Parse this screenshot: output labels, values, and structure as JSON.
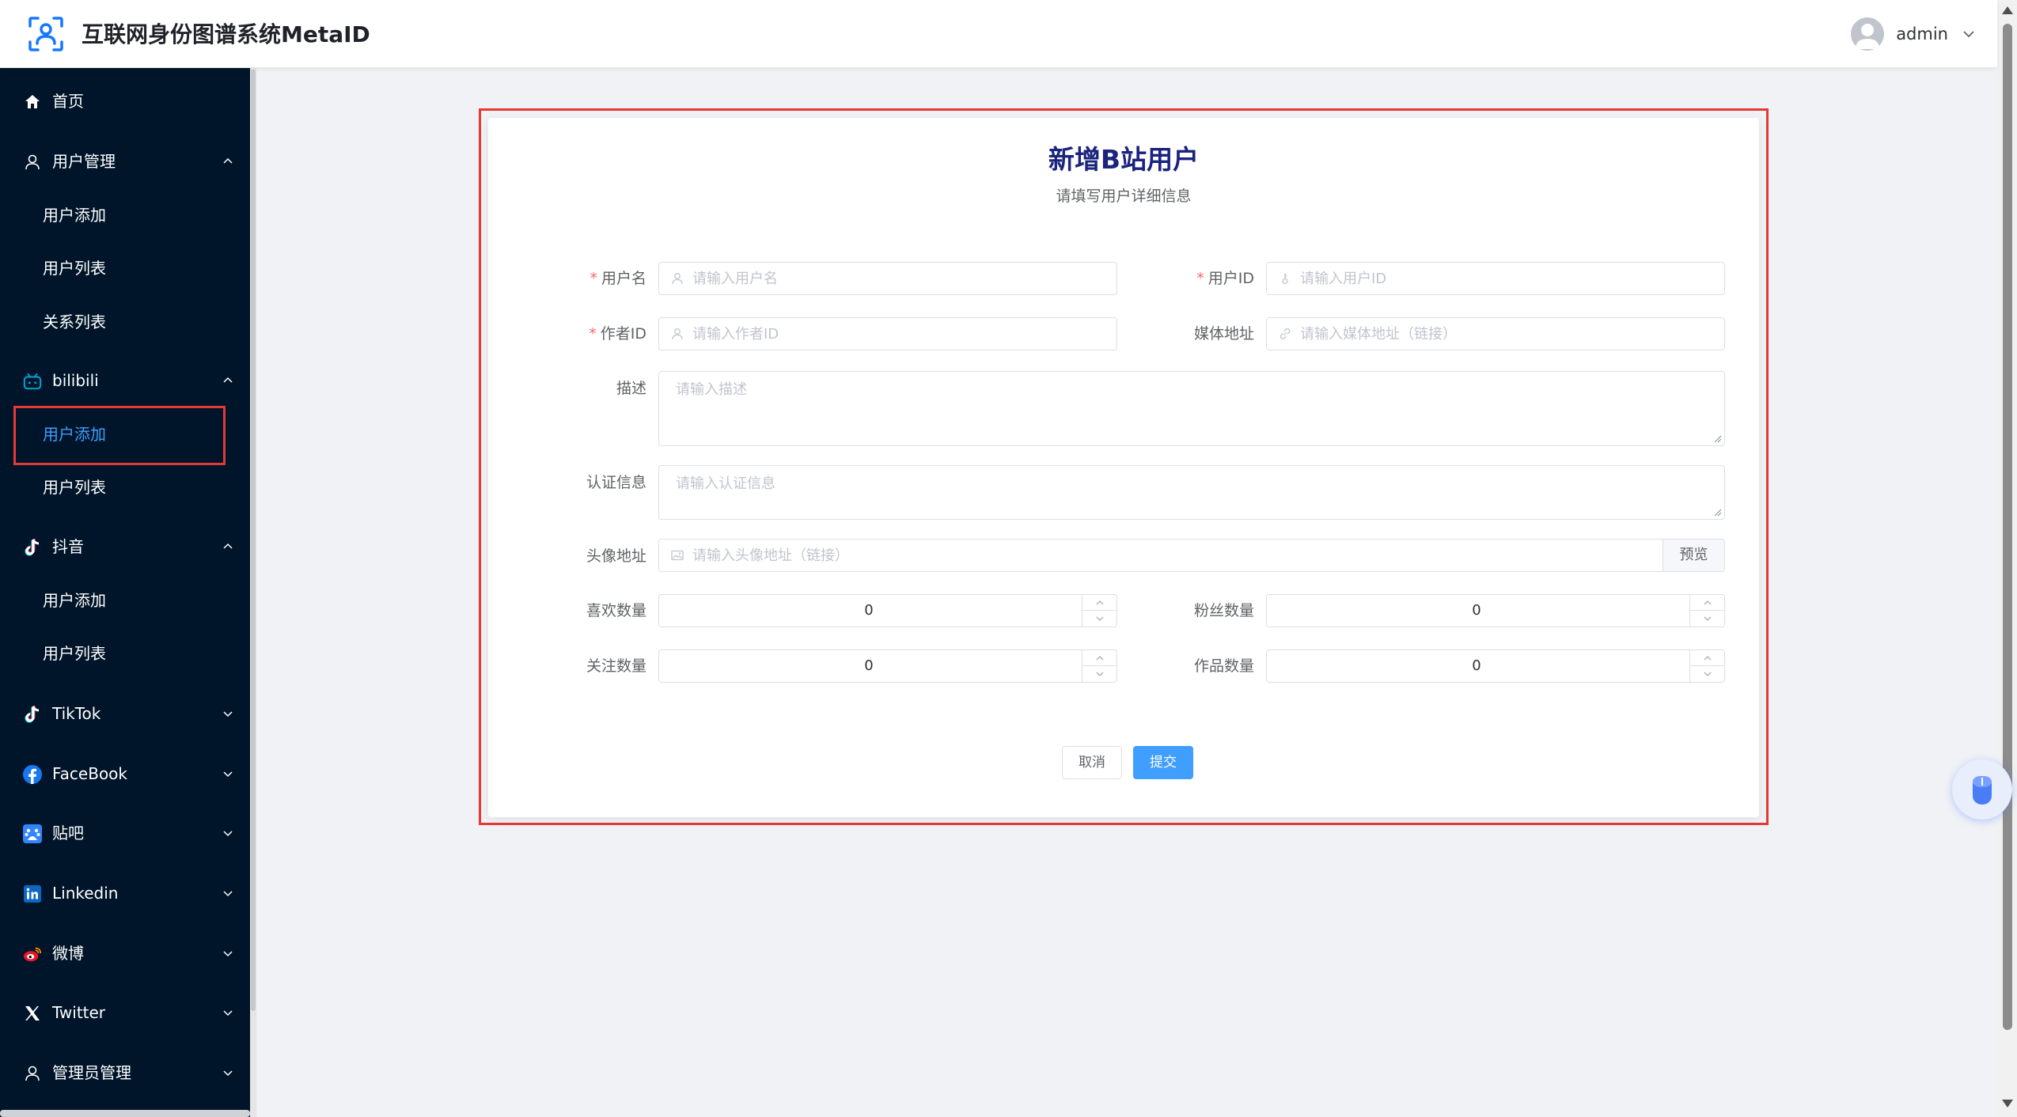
{
  "header": {
    "app_title": "互联网身份图谱系统MetaID",
    "user_name": "admin"
  },
  "sidebar": {
    "items": [
      {
        "label": "首页",
        "icon": "home-icon"
      },
      {
        "label": "用户管理",
        "icon": "user-icon",
        "expanded": true,
        "children": [
          "用户添加",
          "用户列表",
          "关系列表"
        ]
      },
      {
        "label": "bilibili",
        "icon": "bilibili-icon",
        "expanded": true,
        "children": [
          "用户添加",
          "用户列表"
        ]
      },
      {
        "label": "抖音",
        "icon": "douyin-icon",
        "expanded": true,
        "children": [
          "用户添加",
          "用户列表"
        ]
      },
      {
        "label": "TikTok",
        "icon": "tiktok-icon"
      },
      {
        "label": "FaceBook",
        "icon": "facebook-icon"
      },
      {
        "label": "贴吧",
        "icon": "tieba-icon"
      },
      {
        "label": "Linkedin",
        "icon": "linkedin-icon"
      },
      {
        "label": "微博",
        "icon": "weibo-icon"
      },
      {
        "label": "Twitter",
        "icon": "x-icon"
      },
      {
        "label": "管理员管理",
        "icon": "admin-user-icon"
      }
    ],
    "active_item": "bilibili > 用户添加"
  },
  "form": {
    "title": "新增B站用户",
    "subtitle": "请填写用户详细信息",
    "fields": {
      "username": {
        "label": "用户名",
        "placeholder": "请输入用户名",
        "required": true
      },
      "user_id": {
        "label": "用户ID",
        "placeholder": "请输入用户ID",
        "required": true
      },
      "author_id": {
        "label": "作者ID",
        "placeholder": "请输入作者ID",
        "required": true
      },
      "media_url": {
        "label": "媒体地址",
        "placeholder": "请输入媒体地址（链接）"
      },
      "description": {
        "label": "描述",
        "placeholder": "请输入描述"
      },
      "certification": {
        "label": "认证信息",
        "placeholder": "请输入认证信息"
      },
      "avatar_url": {
        "label": "头像地址",
        "placeholder": "请输入头像地址（链接）",
        "button": "预览"
      },
      "likes": {
        "label": "喜欢数量",
        "value": "0"
      },
      "fans": {
        "label": "粉丝数量",
        "value": "0"
      },
      "following": {
        "label": "关注数量",
        "value": "0"
      },
      "works": {
        "label": "作品数量",
        "value": "0"
      }
    },
    "buttons": {
      "cancel": "取消",
      "submit": "提交"
    }
  },
  "colors": {
    "sidebar_bg": "#001529",
    "accent": "#409eff",
    "title": "#1a237e",
    "highlight_box": "#e53935"
  }
}
